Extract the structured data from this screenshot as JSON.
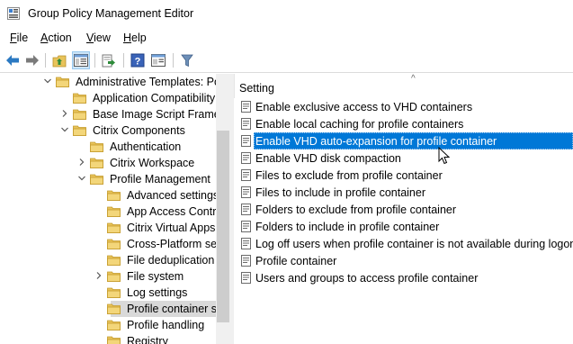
{
  "window": {
    "title": "Group Policy Management Editor"
  },
  "menu": [
    {
      "label": "File",
      "accel": "F",
      "rest": "ile"
    },
    {
      "label": "Action",
      "accel": "A",
      "rest": "ction"
    },
    {
      "label": "View",
      "accel": "V",
      "rest": "iew"
    },
    {
      "label": "Help",
      "accel": "H",
      "rest": "elp"
    }
  ],
  "toolbar": {
    "icons": [
      "back-arrow-icon",
      "forward-arrow-icon",
      "up-folder-icon",
      "show-hide-tree-icon",
      "export-list-icon",
      "help-icon",
      "properties-icon",
      "filter-icon"
    ]
  },
  "tree": {
    "items": [
      {
        "label": "Administrative Templates: Po",
        "level": 0,
        "expander": "expanded"
      },
      {
        "label": "Application Compatibility",
        "level": 1,
        "expander": "none"
      },
      {
        "label": "Base Image Script Framew",
        "level": 1,
        "expander": "collapsed"
      },
      {
        "label": "Citrix Components",
        "level": 1,
        "expander": "expanded"
      },
      {
        "label": "Authentication",
        "level": 2,
        "expander": "none"
      },
      {
        "label": "Citrix Workspace",
        "level": 2,
        "expander": "collapsed"
      },
      {
        "label": "Profile Management",
        "level": 2,
        "expander": "expanded"
      },
      {
        "label": "Advanced settings",
        "level": 3,
        "expander": "none"
      },
      {
        "label": "App Access Contro",
        "level": 3,
        "expander": "none"
      },
      {
        "label": "Citrix Virtual Apps",
        "level": 3,
        "expander": "none"
      },
      {
        "label": "Cross-Platform set",
        "level": 3,
        "expander": "none"
      },
      {
        "label": "File deduplication",
        "level": 3,
        "expander": "none"
      },
      {
        "label": "File system",
        "level": 3,
        "expander": "collapsed"
      },
      {
        "label": "Log settings",
        "level": 3,
        "expander": "none"
      },
      {
        "label": "Profile container s",
        "level": 3,
        "expander": "none",
        "selected": true
      },
      {
        "label": "Profile handling",
        "level": 3,
        "expander": "none"
      },
      {
        "label": "Registry",
        "level": 3,
        "expander": "none"
      }
    ]
  },
  "list": {
    "column_header": "Setting",
    "items": [
      {
        "label": "Enable exclusive access to VHD containers"
      },
      {
        "label": "Enable local caching for profile containers"
      },
      {
        "label": "Enable VHD auto-expansion for profile container",
        "selected": true
      },
      {
        "label": "Enable VHD disk compaction"
      },
      {
        "label": "Files to exclude from profile container"
      },
      {
        "label": "Files to include in profile container"
      },
      {
        "label": "Folders to exclude from profile container"
      },
      {
        "label": "Folders to include in profile container"
      },
      {
        "label": "Log off users when profile container is not available during logon"
      },
      {
        "label": "Profile container"
      },
      {
        "label": "Users and groups to access profile container"
      }
    ]
  },
  "colors": {
    "selection": "#0078d7",
    "tree_selection": "#d9d9d9",
    "folder": "#e8c35a"
  }
}
